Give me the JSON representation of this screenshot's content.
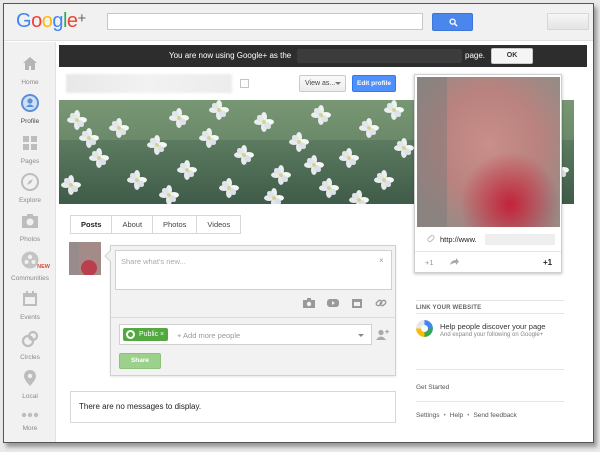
{
  "app": {
    "logo_text": "Google",
    "logo_plus": "+"
  },
  "nav": {
    "items": [
      {
        "label": "Home",
        "icon": "home-icon"
      },
      {
        "label": "Profile",
        "icon": "profile-icon"
      },
      {
        "label": "Pages",
        "icon": "pages-icon"
      },
      {
        "label": "Explore",
        "icon": "explore-icon"
      },
      {
        "label": "Photos",
        "icon": "photos-icon"
      },
      {
        "label": "Communities",
        "icon": "communities-icon",
        "badge": "NEW"
      },
      {
        "label": "Events",
        "icon": "events-icon"
      },
      {
        "label": "Circles",
        "icon": "circles-icon"
      },
      {
        "label": "Local",
        "icon": "local-icon"
      },
      {
        "label": "More",
        "icon": "more-icon"
      }
    ],
    "active": "Profile"
  },
  "notification": {
    "text_before": "You are now using Google+ as the",
    "text_after": "page.",
    "ok_label": "OK"
  },
  "header": {
    "view_as_label": "View as...",
    "edit_profile_label": "Edit profile"
  },
  "profile_card": {
    "url_text": "http://www.",
    "plus_one_left": "+1",
    "plus_one_right": "+1"
  },
  "tabs": [
    {
      "label": "Posts",
      "active": true
    },
    {
      "label": "About",
      "active": false
    },
    {
      "label": "Photos",
      "active": false
    },
    {
      "label": "Videos",
      "active": false
    }
  ],
  "share": {
    "placeholder": "Share what's new...",
    "close_glyph": "×",
    "chip_label": "Public",
    "chip_remove": "×",
    "add_people_placeholder": "+ Add more people",
    "share_button_label": "Share"
  },
  "stream": {
    "empty_message": "There are no messages to display."
  },
  "sidebar": {
    "link_heading": "LINK YOUR WEBSITE",
    "help_title": "Help people discover your page",
    "help_subtitle": "And expand your following on Google+",
    "get_started": "Get Started",
    "footer": [
      "Settings",
      "Help",
      "Send feedback"
    ],
    "footer_separator": "•"
  },
  "colors": {
    "brand_blue": "#4285f4",
    "edit_button": "#4d90fe",
    "public_chip": "#53a93f",
    "share_button": "#9bd18a",
    "notify_bar": "#2d2d2d",
    "new_badge": "#dd4b39"
  }
}
